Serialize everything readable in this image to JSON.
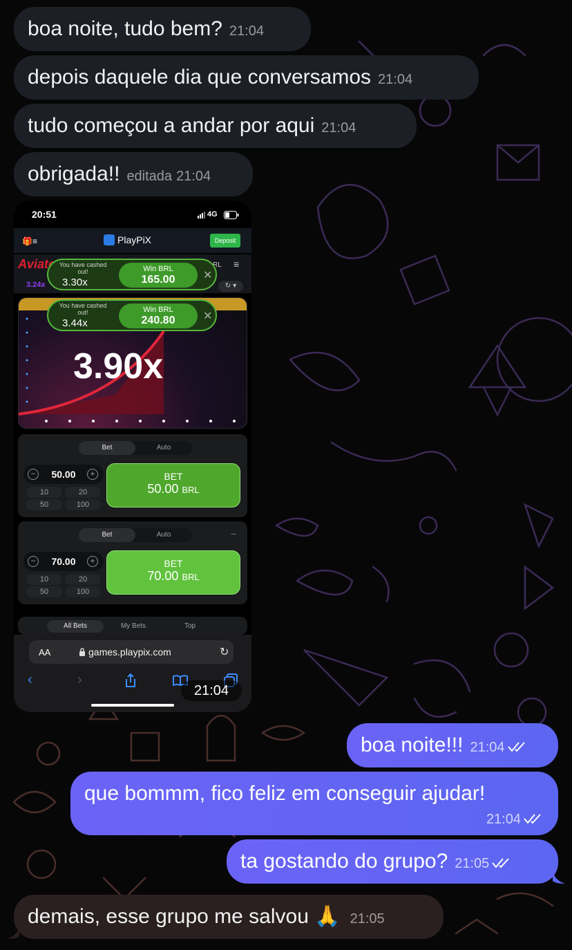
{
  "incoming_1": {
    "text": "boa noite, tudo bem?",
    "time": "21:04"
  },
  "incoming_2": {
    "text": "depois daquele dia que conversamos",
    "time": "21:04"
  },
  "incoming_3": {
    "text": "tudo começou a andar por aqui",
    "time": "21:04"
  },
  "incoming_4": {
    "text": "obrigada!!",
    "edited": "editada",
    "time": "21:04"
  },
  "photo": {
    "time": "21:04",
    "phone_time": "20:51",
    "network": "4G",
    "brand": "PlayPiX",
    "deposit_label": "Deposit",
    "game_name": "Aviator",
    "currency_fragment": "RL",
    "history_value": "3.24x",
    "multiplier": "3.90x",
    "cashouts": [
      {
        "label": "You have cashed out!",
        "mult": "3.30x",
        "win_label": "Win BRL",
        "win_value": "165.00"
      },
      {
        "label": "You have cashed out!",
        "mult": "3.44x",
        "win_label": "Win BRL",
        "win_value": "240.80"
      }
    ],
    "panels": [
      {
        "tab_bet": "Bet",
        "tab_auto": "Auto",
        "amount": "50.00",
        "chips": [
          "10",
          "20",
          "50",
          "100"
        ],
        "btn_title": "BET",
        "btn_amount": "50.00",
        "btn_currency": "BRL",
        "btn_color": "#4fa72c"
      },
      {
        "tab_bet": "Bet",
        "tab_auto": "Auto",
        "amount": "70.00",
        "chips": [
          "10",
          "20",
          "50",
          "100"
        ],
        "btn_title": "BET",
        "btn_amount": "70.00",
        "btn_currency": "BRL",
        "btn_color": "#60c23d"
      }
    ],
    "bets_tabs": [
      "All Bets",
      "My Bets",
      "Top"
    ],
    "url_aa": "AA",
    "url": "games.playpix.com"
  },
  "outgoing_1": {
    "text": "boa noite!!!",
    "time": "21:04",
    "status": "read"
  },
  "outgoing_2": {
    "text": "que bommm, fico feliz em conseguir ajudar!",
    "time": "21:04",
    "status": "read"
  },
  "outgoing_3": {
    "text": "ta gostando do grupo?",
    "time": "21:05",
    "status": "read"
  },
  "incoming_5": {
    "text": "demais, esse grupo me salvou",
    "emoji": "🙏",
    "time": "21:05"
  },
  "colors": {
    "outgoing_bubble": "#6b63f7",
    "incoming_bubble": "#1d1f26",
    "background": "#070708"
  }
}
